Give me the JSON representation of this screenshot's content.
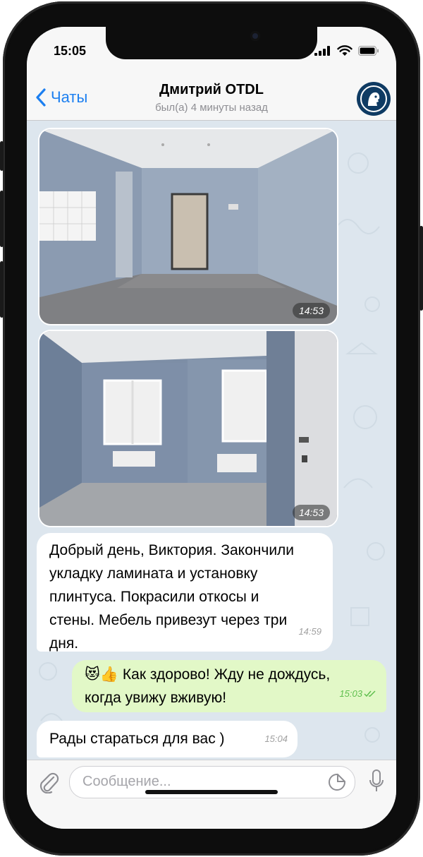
{
  "status_bar": {
    "time": "15:05"
  },
  "header": {
    "back_label": "Чаты",
    "contact_name": "Дмитрий OTDL",
    "last_seen": "был(а) 4 минуты назад"
  },
  "messages": [
    {
      "type": "photo",
      "description": "room-with-door",
      "time": "14:53"
    },
    {
      "type": "photo",
      "description": "room-with-windows",
      "time": "14:53"
    },
    {
      "type": "text",
      "direction": "in",
      "lines": [
        "Добрый день, Виктория. Закончили",
        "укладку ламината и установку",
        "плинтуса. Покрасили откосы и",
        "стены. Мебель привезут через три",
        "дня."
      ],
      "time": "14:59"
    },
    {
      "type": "text",
      "direction": "out",
      "emoji": [
        "😻",
        "👍"
      ],
      "lines": [
        "Как здорово! Жду не дождусь,",
        "когда увижу вживую!"
      ],
      "time": "15:03"
    },
    {
      "type": "text",
      "direction": "in",
      "lines": [
        "Рады стараться для вас )"
      ],
      "time": "15:04"
    }
  ],
  "composer": {
    "placeholder": "Сообщение..."
  },
  "colors": {
    "accent": "#1c7ff0",
    "outgoing_bubble": "#e2f8c7",
    "read_check": "#5fbf4e"
  }
}
